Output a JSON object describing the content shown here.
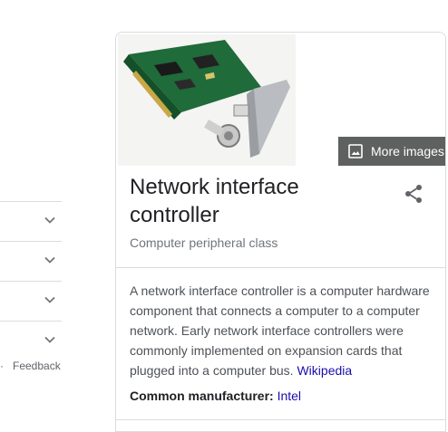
{
  "left": {
    "rows": [
      {
        "icon": "chevron-down-icon"
      },
      {
        "icon": "chevron-down-icon"
      },
      {
        "icon": "chevron-down-icon"
      },
      {
        "icon": "chevron-down-icon"
      }
    ],
    "dot": "·",
    "feedback_label": "Feedback"
  },
  "panel": {
    "image_alt_icon": "network-card-image",
    "more_images_label": "More images",
    "title": "Network interface controller",
    "share_icon": "share-icon",
    "subtitle": "Computer peripheral class",
    "description": "A network interface controller is a computer hardware component that connects a computer to a computer network. Early network interface controllers were commonly implemented on expansion cards that plugged into a computer bus.",
    "source_link": "Wikipedia",
    "fact_label": "Common manufacturer:",
    "fact_value": "Intel"
  },
  "colors": {
    "link": "#1a0dab",
    "more_images_bg": "#5f6060",
    "border": "#dadce0"
  }
}
